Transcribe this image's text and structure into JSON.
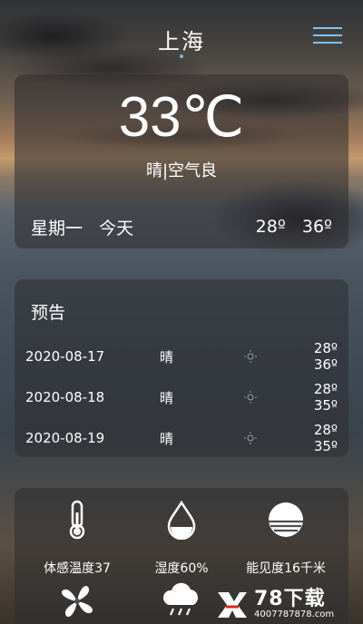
{
  "header": {
    "city": "上海",
    "menu_icon": "hamburger-menu-icon"
  },
  "current": {
    "temperature": "33℃",
    "condition": "晴|空气良",
    "weekday": "星期一",
    "day_label": "今天",
    "low": "28º",
    "high": "36º"
  },
  "forecast": {
    "title": "预告",
    "rows": [
      {
        "date": "2020-08-17",
        "condition": "晴",
        "icon": "sun-icon",
        "low": "28º",
        "high": "36º"
      },
      {
        "date": "2020-08-18",
        "condition": "晴",
        "icon": "sun-icon",
        "low": "28º",
        "high": "35º"
      },
      {
        "date": "2020-08-19",
        "condition": "晴",
        "icon": "sun-icon",
        "low": "28º",
        "high": "35º"
      }
    ]
  },
  "details": {
    "items": [
      {
        "label": "体感温度37",
        "icon": "thermometer-icon"
      },
      {
        "label": "湿度60%",
        "icon": "water-drop-icon"
      },
      {
        "label": "能见度16千米",
        "icon": "visibility-icon"
      },
      {
        "label": "",
        "icon": "fan-icon"
      },
      {
        "label": "",
        "icon": "rain-cloud-icon"
      }
    ]
  },
  "watermark": {
    "brand": "78下载",
    "url": "4007787878.com"
  },
  "colors": {
    "accent": "#7fc4ef"
  }
}
